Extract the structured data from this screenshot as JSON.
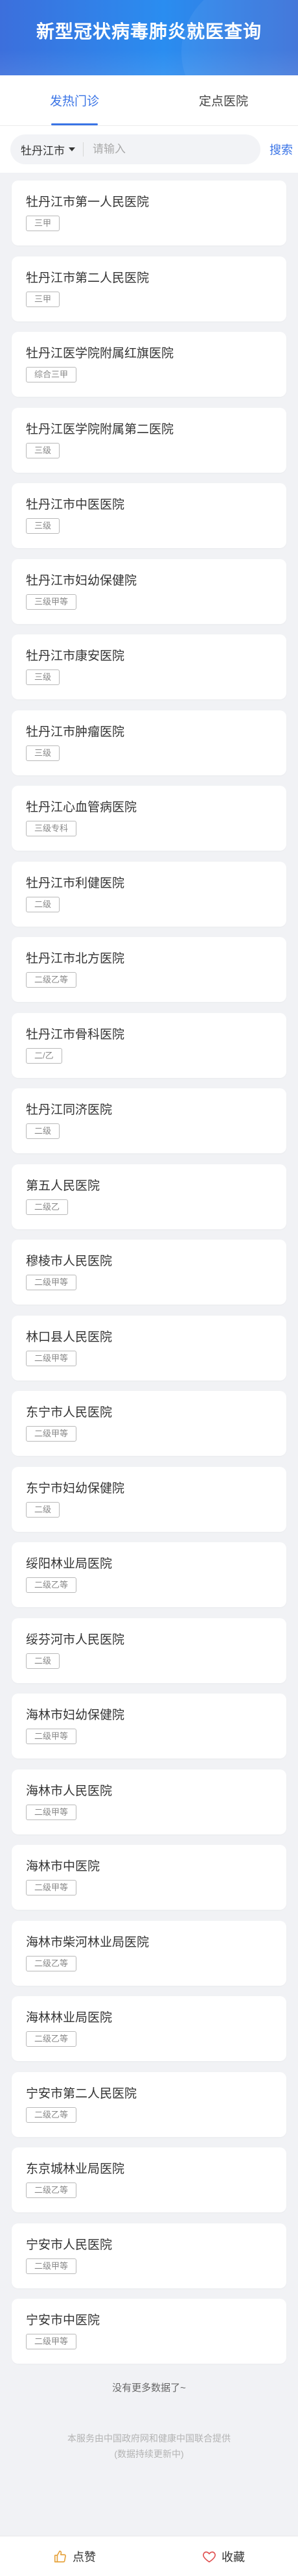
{
  "header": {
    "title": "新型冠状病毒肺炎就医查询"
  },
  "tabs": [
    {
      "label": "发热门诊"
    },
    {
      "label": "定点医院"
    }
  ],
  "search": {
    "city": "牡丹江市",
    "placeholder": "请输入",
    "button_label": "搜索"
  },
  "hospitals": [
    {
      "name": "牡丹江市第一人民医院",
      "grade": "三甲"
    },
    {
      "name": "牡丹江市第二人民医院",
      "grade": "三甲"
    },
    {
      "name": "牡丹江医学院附属红旗医院",
      "grade": "综合三甲"
    },
    {
      "name": "牡丹江医学院附属第二医院",
      "grade": "三级"
    },
    {
      "name": "牡丹江市中医医院",
      "grade": "三级"
    },
    {
      "name": "牡丹江市妇幼保健院",
      "grade": "三级甲等"
    },
    {
      "name": "牡丹江市康安医院",
      "grade": "三级"
    },
    {
      "name": "牡丹江市肿瘤医院",
      "grade": "三级"
    },
    {
      "name": "牡丹江心血管病医院",
      "grade": "三级专科"
    },
    {
      "name": "牡丹江市利健医院",
      "grade": "二级"
    },
    {
      "name": "牡丹江市北方医院",
      "grade": "二级乙等"
    },
    {
      "name": "牡丹江市骨科医院",
      "grade": "二/乙"
    },
    {
      "name": "牡丹江同济医院",
      "grade": "二级"
    },
    {
      "name": "第五人民医院",
      "grade": "二级乙"
    },
    {
      "name": "穆棱市人民医院",
      "grade": "二级甲等"
    },
    {
      "name": "林口县人民医院",
      "grade": "二级甲等"
    },
    {
      "name": "东宁市人民医院",
      "grade": "二级甲等"
    },
    {
      "name": "东宁市妇幼保健院",
      "grade": "二级"
    },
    {
      "name": "绥阳林业局医院",
      "grade": "二级乙等"
    },
    {
      "name": "绥芬河市人民医院",
      "grade": "二级"
    },
    {
      "name": "海林市妇幼保健院",
      "grade": "二级甲等"
    },
    {
      "name": "海林市人民医院",
      "grade": "二级甲等"
    },
    {
      "name": "海林市中医院",
      "grade": "二级甲等"
    },
    {
      "name": "海林市柴河林业局医院",
      "grade": "二级乙等"
    },
    {
      "name": "海林林业局医院",
      "grade": "二级乙等"
    },
    {
      "name": "宁安市第二人民医院",
      "grade": "二级乙等"
    },
    {
      "name": "东京城林业局医院",
      "grade": "二级乙等"
    },
    {
      "name": "宁安市人民医院",
      "grade": "二级甲等"
    },
    {
      "name": "宁安市中医院",
      "grade": "二级甲等"
    }
  ],
  "list_end_text": "没有更多数据了~",
  "footer": {
    "source_line": "本服务由中国政府网和健康中国联合提供",
    "update_line": "(数据持续更新中)"
  },
  "bottom_bar": {
    "like_label": "点赞",
    "like_icon": "thumbs-up-icon",
    "favorite_label": "收藏",
    "favorite_icon": "heart-icon"
  },
  "colors": {
    "accent": "#3a74e6",
    "like_icon": "#e6a23c",
    "favorite_icon": "#e05252"
  }
}
